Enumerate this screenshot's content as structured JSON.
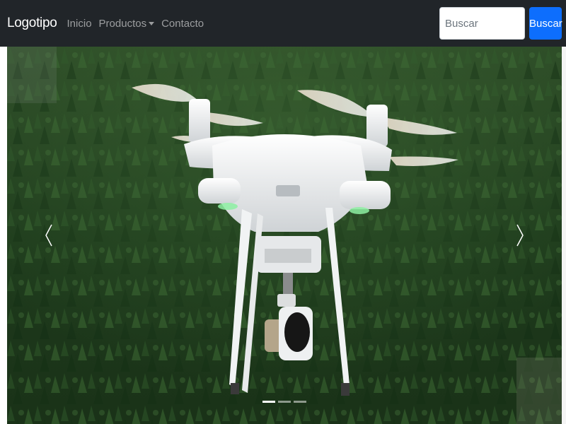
{
  "navbar": {
    "brand": "Logotipo",
    "links": [
      {
        "label": "Inicio"
      },
      {
        "label": "Productos",
        "dropdown": true
      },
      {
        "label": "Contacto"
      }
    ],
    "search": {
      "placeholder": "Buscar",
      "value": "",
      "button_label": "Buscar"
    }
  },
  "carousel": {
    "slide_image": "drone-over-forest",
    "slide_count": 3,
    "active_index": 0,
    "prev_icon": "chevron-left-icon",
    "next_icon": "chevron-right-icon"
  },
  "colors": {
    "navbar_bg": "#212529",
    "primary": "#0d6efd"
  }
}
